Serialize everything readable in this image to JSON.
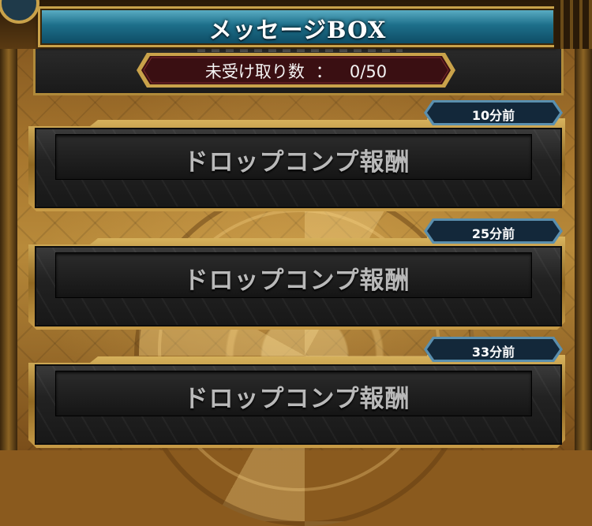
{
  "header": {
    "title": "メッセージBOX"
  },
  "counter": {
    "label": "未受け取り数",
    "separator": "：",
    "value": "0/50"
  },
  "messages": [
    {
      "title": "ドロップコンプ報酬",
      "time": "10分前"
    },
    {
      "title": "ドロップコンプ報酬",
      "time": "25分前"
    },
    {
      "title": "ドロップコンプ報酬",
      "time": "33分前"
    }
  ],
  "colors": {
    "header_blue": "#1d6f8a",
    "gold_frame": "#c9a24a",
    "card_dark": "#222222",
    "tab_navy": "#13283a",
    "counter_maroon": "#3a0f12"
  }
}
